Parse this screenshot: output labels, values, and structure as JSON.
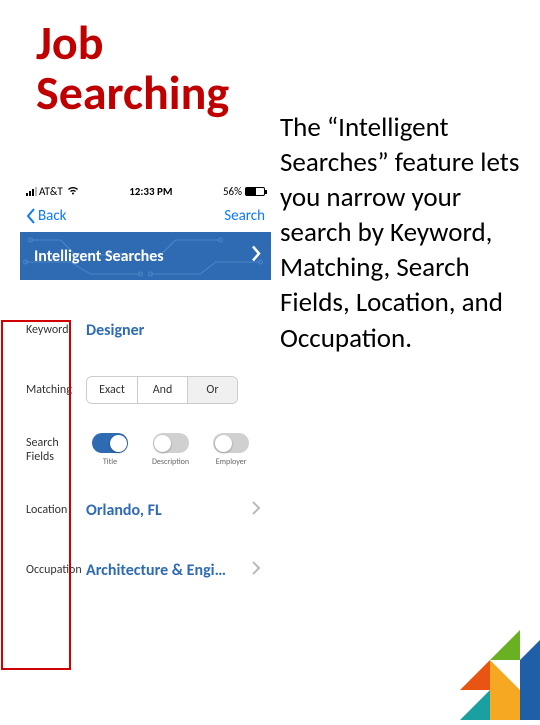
{
  "title_line1": "Job",
  "title_line2": "Searching",
  "description": "The “Intelligent Searches” feature lets you narrow your search by Keyword, Matching, Search Fields, Location, and Occupation.",
  "status": {
    "carrier": "AT&T",
    "time": "12:33 PM",
    "battery": "56%"
  },
  "nav": {
    "back": "Back",
    "action": "Search"
  },
  "band": "Intelligent Searches",
  "filters": {
    "keyword": {
      "label": "Keyword",
      "value": "Designer"
    },
    "matching": {
      "label": "Matching",
      "options": [
        "Exact",
        "And",
        "Or"
      ],
      "selected": "Or"
    },
    "searchFields": {
      "label": "Search Fields",
      "items": [
        "Title",
        "Description",
        "Employer"
      ],
      "on": [
        true,
        false,
        false
      ]
    },
    "location": {
      "label": "Location",
      "value": "Orlando, FL"
    },
    "occupation": {
      "label": "Occupation",
      "value": "Architecture & Engi…"
    }
  }
}
